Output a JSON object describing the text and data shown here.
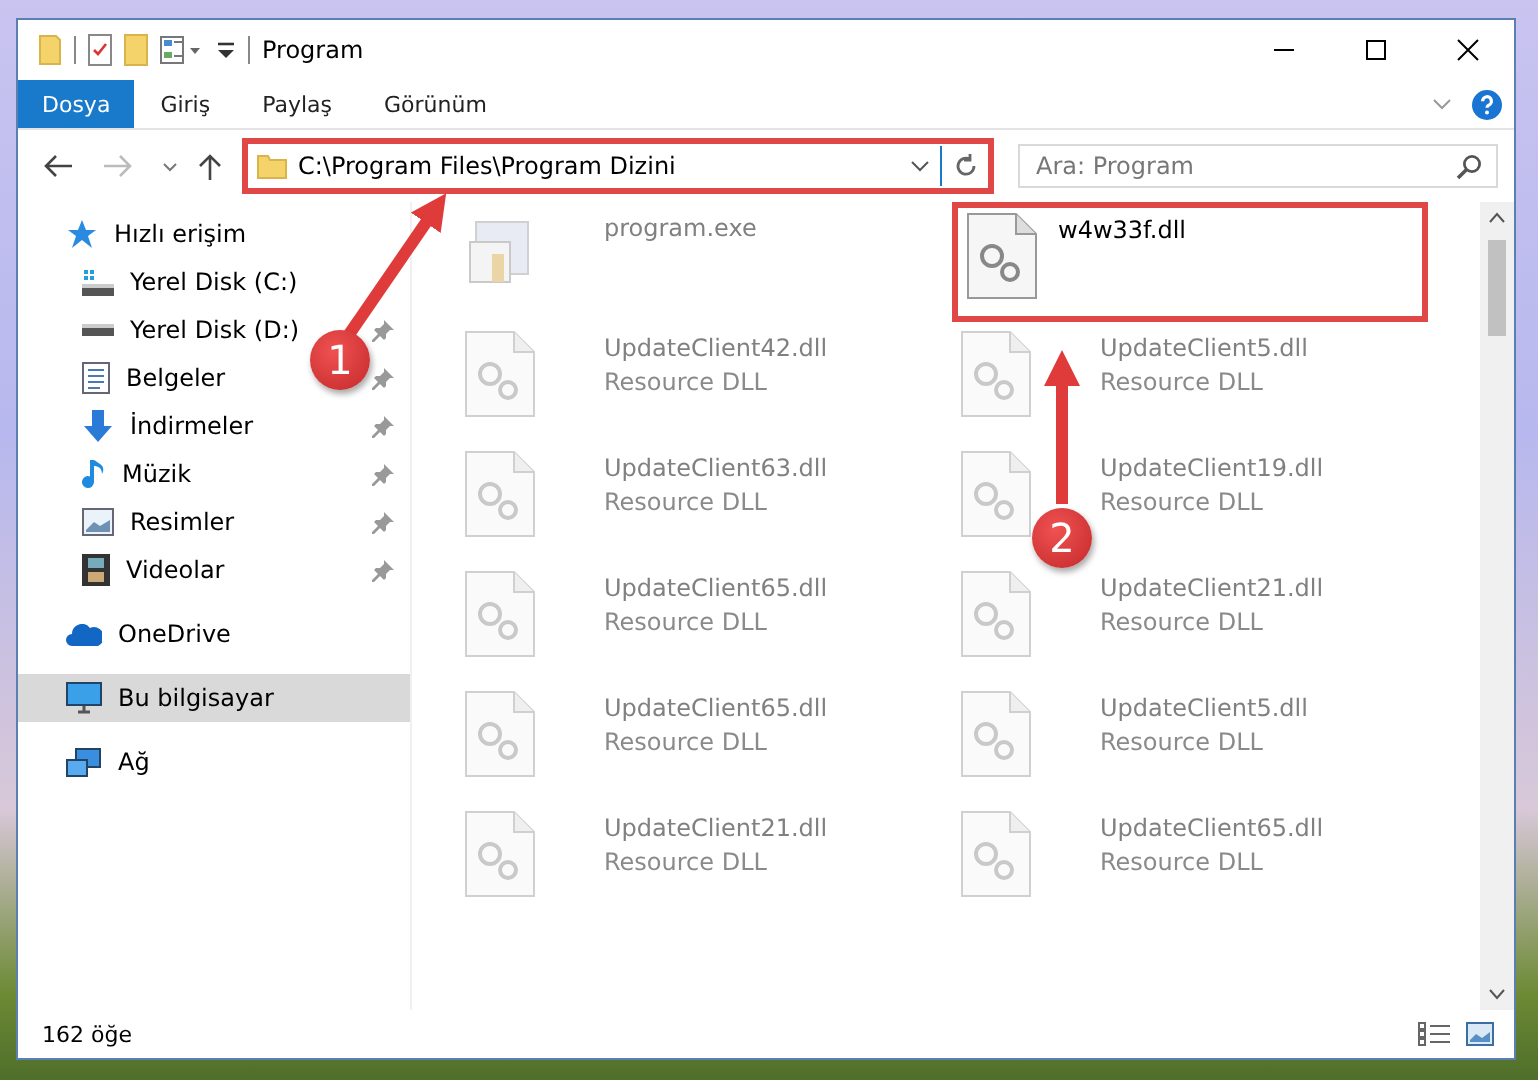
{
  "window": {
    "title": "Program"
  },
  "ribbon_tabs": [
    {
      "label": "Dosya",
      "kind": "file"
    },
    {
      "label": "Giriş",
      "kind": "tab"
    },
    {
      "label": "Paylaş",
      "kind": "tab"
    },
    {
      "label": "Görünüm",
      "kind": "tab"
    }
  ],
  "address_bar": {
    "path": "C:\\Program Files\\Program Dizini",
    "highlighted": true
  },
  "search": {
    "placeholder": "Ara: Program"
  },
  "sidebar": {
    "items": [
      {
        "label": "Hızlı erişim",
        "kind": "star",
        "selected": false,
        "children": [
          {
            "label": "Yerel Disk (C:)",
            "kind": "drive-c",
            "pinned": false,
            "selected": false
          },
          {
            "label": "Yerel Disk (D:)",
            "kind": "drive",
            "pinned": true,
            "selected": false
          },
          {
            "label": "Belgeler",
            "kind": "document",
            "pinned": true,
            "selected": false
          },
          {
            "label": "İndirmeler",
            "kind": "download",
            "pinned": true,
            "selected": false
          },
          {
            "label": "Müzik",
            "kind": "music",
            "pinned": true,
            "selected": false
          },
          {
            "label": "Resimler",
            "kind": "picture",
            "pinned": true,
            "selected": false
          },
          {
            "label": "Videolar",
            "kind": "video",
            "pinned": true,
            "selected": false
          }
        ]
      },
      {
        "label": "OneDrive",
        "kind": "cloud",
        "selected": false
      },
      {
        "label": "Bu bilgisayar",
        "kind": "computer",
        "selected": true
      },
      {
        "label": "Ağ",
        "kind": "network",
        "selected": false
      }
    ]
  },
  "files": [
    {
      "name": "program.exe",
      "kind": "exe",
      "dimmed": true,
      "highlighted": false
    },
    {
      "name": "w4w33f.dll",
      "kind": "dll",
      "dimmed": false,
      "highlighted": true
    },
    {
      "name": "UpdateClient42.dll",
      "description": "Resource DLL",
      "kind": "dll",
      "dimmed": true,
      "highlighted": false
    },
    {
      "name": "UpdateClient5.dll",
      "description": "Resource DLL",
      "kind": "dll",
      "dimmed": true,
      "highlighted": false
    },
    {
      "name": "UpdateClient63.dll",
      "description": "Resource DLL",
      "kind": "dll",
      "dimmed": true,
      "highlighted": false
    },
    {
      "name": "UpdateClient19.dll",
      "description": "Resource DLL",
      "kind": "dll",
      "dimmed": true,
      "highlighted": false
    },
    {
      "name": "UpdateClient65.dll",
      "description": "Resource DLL",
      "kind": "dll",
      "dimmed": true,
      "highlighted": false
    },
    {
      "name": "UpdateClient21.dll",
      "description": "Resource DLL",
      "kind": "dll",
      "dimmed": true,
      "highlighted": false
    },
    {
      "name": "UpdateClient65.dll",
      "description": "Resource DLL",
      "kind": "dll",
      "dimmed": true,
      "highlighted": false
    },
    {
      "name": "UpdateClient5.dll",
      "description": "Resource DLL",
      "kind": "dll",
      "dimmed": true,
      "highlighted": false
    },
    {
      "name": "UpdateClient21.dll",
      "description": "Resource DLL",
      "kind": "dll",
      "dimmed": true,
      "highlighted": false
    },
    {
      "name": "UpdateClient65.dll",
      "description": "Resource DLL",
      "kind": "dll",
      "dimmed": true,
      "highlighted": false
    }
  ],
  "status_bar": {
    "item_count": "162 öğe"
  },
  "annotations": [
    {
      "number": "1"
    },
    {
      "number": "2"
    }
  ]
}
